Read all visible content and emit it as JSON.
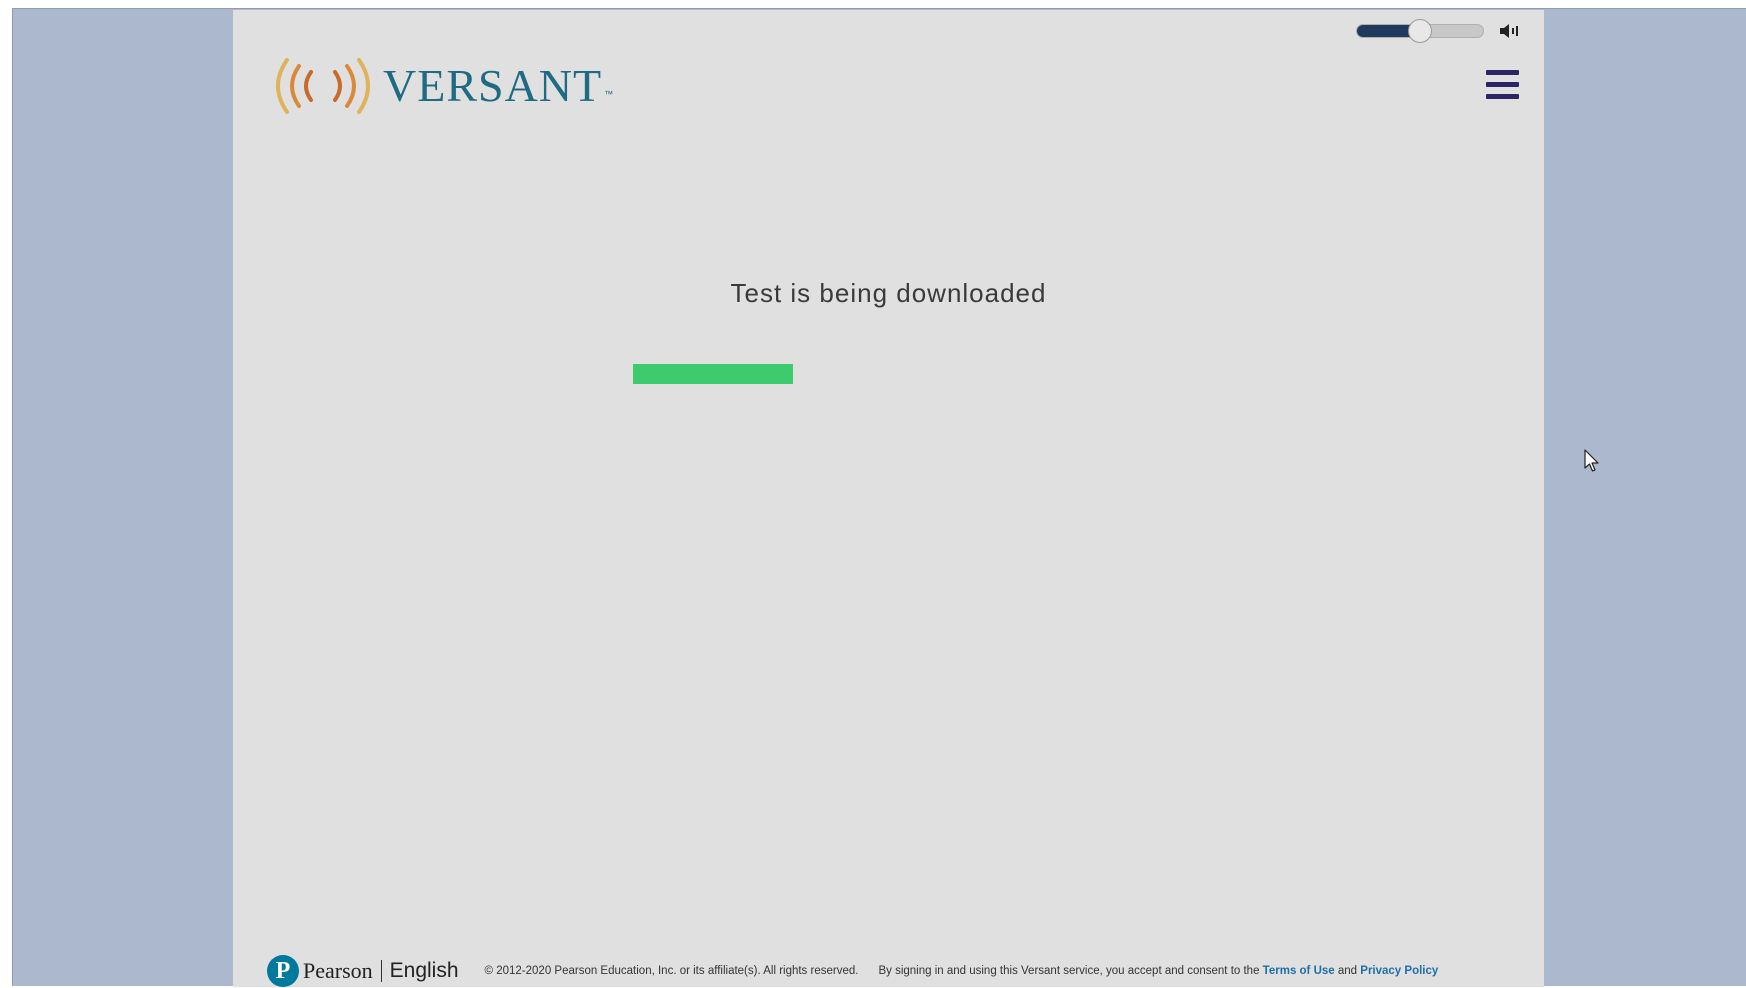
{
  "header": {
    "logo_text": "VERSANT",
    "logo_tm": "™",
    "volume": {
      "level": 0.5,
      "icon": "speaker-icon"
    },
    "menu_icon": "hamburger-menu-icon"
  },
  "main": {
    "status_text": "Test is being downloaded",
    "progress": {
      "percent": 32,
      "color": "#3ecb6e"
    }
  },
  "footer": {
    "pearson_mark": "P",
    "pearson_name": "Pearson",
    "pearson_english": "English",
    "copyright": "© 2012-2020 Pearson Education, Inc. or its affiliate(s). All rights reserved.",
    "consent_prefix": "By signing in and using this Versant service, you accept and consent to the",
    "terms_link": "Terms of Use",
    "and_text": "and",
    "privacy_link": "Privacy Policy"
  },
  "colors": {
    "app_background": "#e0e0e0",
    "outer_background": "#abb8cd",
    "brand_teal": "#1f6b84",
    "menu_icon": "#2b2566",
    "link": "#1d6fa8"
  }
}
